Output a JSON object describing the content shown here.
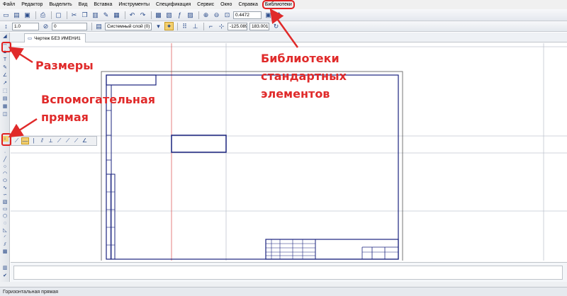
{
  "menu": {
    "items": [
      "Файл",
      "Редактор",
      "Выделить",
      "Вид",
      "Вставка",
      "Инструменты",
      "Спецификация",
      "Сервис",
      "Окно",
      "Справка",
      "Библиотеки"
    ]
  },
  "toolbar": {
    "scale_value": "1.0",
    "style_value": "0",
    "layer_value": "Системный слой (0)",
    "zoom_value": "0.4472",
    "coord_x": "-125.089",
    "coord_y": "183.001"
  },
  "document": {
    "tab_title": "Чертеж БЕЗ ИМЕНИ1"
  },
  "status": {
    "text": "Горизонтальная прямая"
  },
  "annotations": {
    "dimensions": "Размеры",
    "aux_line_1": "Вспомогательная",
    "aux_line_2": "прямая",
    "library_1": "Библиотеки",
    "library_2": "стандартных",
    "library_3": "элементов"
  },
  "colors": {
    "annotation": "#e02a2a",
    "frame": "#1a237e",
    "aux_line": "#c0c6d0",
    "red_axis": "#e06060"
  },
  "icons": {
    "left_toolbar": [
      "dimensions-icon",
      "aux-line-icon",
      "geometry-icon",
      "text-icon",
      "symbols-icon",
      "edit-icon",
      "measure-icon",
      "select-icon",
      "spec-icon",
      "report-icon"
    ]
  }
}
